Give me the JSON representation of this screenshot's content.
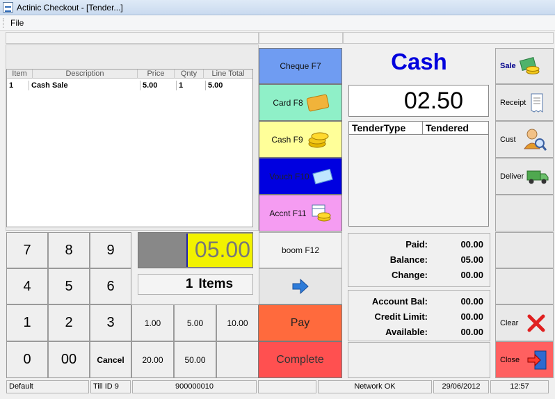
{
  "window": {
    "title": "Actinic Checkout - [Tender...]"
  },
  "menu": {
    "file_label": "File"
  },
  "grid": {
    "headers": [
      "Item",
      "Description",
      "Price",
      "Qnty",
      "Line Total"
    ],
    "rows": [
      {
        "item": "1",
        "description": "Cash Sale",
        "price": "5.00",
        "qnty": "1",
        "line_total": "5.00"
      }
    ]
  },
  "keypad": {
    "keys": [
      "7",
      "8",
      "9",
      "4",
      "5",
      "6",
      "1",
      "2",
      "3",
      "0",
      "00",
      "Cancel"
    ]
  },
  "total_display": "05.00",
  "items": {
    "count": "1",
    "label": "Items"
  },
  "quick_amounts": [
    "1.00",
    "5.00",
    "10.00",
    "20.00",
    "50.00"
  ],
  "tender_buttons": {
    "cheque": "Cheque F7",
    "card": "Card F8",
    "cash": "Cash F9",
    "voucher": "Vouch F10",
    "account": "Accnt F11",
    "boom": "boom F12"
  },
  "actions": {
    "pay": "Pay",
    "complete": "Complete"
  },
  "tender": {
    "mode": "Cash",
    "amount": "02.50",
    "table_headers": [
      "TenderType",
      "Tendered"
    ]
  },
  "summary": {
    "paid_label": "Paid:",
    "paid": "00.00",
    "balance_label": "Balance:",
    "balance": "05.00",
    "change_label": "Change:",
    "change": "00.00",
    "account_bal_label": "Account Bal:",
    "account_bal": "00.00",
    "credit_limit_label": "Credit Limit:",
    "credit_limit": "00.00",
    "available_label": "Available:",
    "available": "00.00"
  },
  "side_buttons": {
    "sale": "Sale",
    "receipt": "Receipt",
    "cust": "Cust",
    "deliver": "Deliver",
    "clear": "Clear",
    "close": "Close"
  },
  "status": {
    "profile": "Default",
    "till": "Till ID 9",
    "code": "900000010",
    "network": "Network OK",
    "date": "29/06/2012",
    "time": "12:57"
  },
  "colors": {
    "cheque": "#6f9cf2",
    "card": "#8ff0c8",
    "cash": "#ffff99",
    "voucher": "#0000e0",
    "account": "#f59cf2",
    "pay": "#ff6a3d",
    "complete": "#ff5050",
    "close": "#ff6060",
    "cash_title": "#0000dd",
    "total_bg": "#f2f200"
  }
}
